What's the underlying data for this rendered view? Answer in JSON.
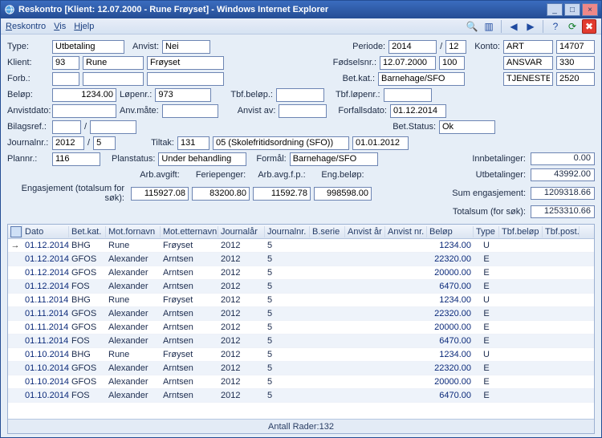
{
  "title": "Reskontro [Klient: 12.07.2000 - Rune Frøyset] - Windows Internet Explorer",
  "menu": {
    "reskontro": "Reskontro",
    "vis": "Vis",
    "hjelp": "Hjelp"
  },
  "form": {
    "labels": {
      "type": "Type:",
      "klient": "Klient:",
      "forb": "Forb.:",
      "anvist": "Anvist:",
      "periode": "Periode:",
      "fodselsnr": "Fødselsnr.:",
      "betkat": "Bet.kat.:",
      "konto": "Konto:",
      "belop": "Beløp:",
      "lopenr": "Løpenr.:",
      "tbfbelop": "Tbf.beløp.:",
      "tbflopenr": "Tbf.løpenr.:",
      "anvistdato": "Anvistdato:",
      "anvmate": "Anv.måte:",
      "anvistav": "Anvist av:",
      "forfallsdato": "Forfallsdato:",
      "betstatus": "Bet.Status:",
      "bilagsref": "Bilagsref.:",
      "journalnr": "Journalnr.:",
      "tiltak": "Tiltak:",
      "plannr": "Plannr.:",
      "planstatus": "Planstatus:",
      "formal": "Formål:",
      "engasjement": "Engasjement (totalsum for søk):",
      "arbavgift": "Arb.avgift:",
      "feriepenger": "Feriepenger:",
      "arbavgfp": "Arb.avg.f.p.:",
      "engbelop": "Eng.beløp:",
      "innbetalinger": "Innbetalinger:",
      "utbetalinger": "Utbetalinger:",
      "sumengasjement": "Sum engasjement:",
      "totalsum": "Totalsum (for søk):"
    },
    "values": {
      "type": "Utbetaling",
      "anvist": "Nei",
      "klient_id": "93",
      "klient_fn": "Rune",
      "klient_en": "Frøyset",
      "periode_y": "2014",
      "periode_m": "12",
      "fodselsnr_d": "12.07.2000",
      "fodselsnr_n": "100",
      "betkat": "Barnehage/SFO",
      "konto1l": "ART",
      "konto1v": "14707",
      "konto2l": "ANSVAR",
      "konto2v": "330",
      "konto3l": "TJENESTE",
      "konto3v": "2520",
      "belop": "1234.00",
      "lopenr": "973",
      "tbfbelop": "",
      "tbflopenr": "",
      "anvistdato": "",
      "anvmate": "",
      "anvistav": "",
      "forfallsdato": "01.12.2014",
      "betstatus": "Ok",
      "bilagsref1": "",
      "bilagsref2": "",
      "journalnr_y": "2012",
      "journalnr_n": "5",
      "tiltak_n": "131",
      "tiltak_txt": "05 (Skolefritidsordning (SFO))",
      "tiltak_d": "01.01.2012",
      "plannr": "116",
      "planstatus": "Under behandling",
      "formal": "Barnehage/SFO",
      "eng_total": "115927.08",
      "arbavgift": "",
      "feriepenger": "83200.80",
      "arbavgfp": "11592.78",
      "engbelop": "998598.00",
      "innbetalinger": "0.00",
      "utbetalinger": "43992.00",
      "sumengasjement": "1209318.66",
      "totalsum": "1253310.66"
    }
  },
  "table": {
    "headers": {
      "dato": "Dato",
      "betkat": "Bet.kat.",
      "motfornavn": "Mot.fornavn",
      "motetternavn": "Mot.etternavn",
      "journalar": "Journalår",
      "journalnr": "Journalnr.",
      "bserie": "B.serie",
      "anvistar": "Anvist år",
      "anvistnr": "Anvist nr.",
      "belop": "Beløp",
      "type": "Type",
      "tbfbelop": "Tbf.beløp",
      "tbfpost": "Tbf.post."
    },
    "rows": [
      {
        "dato": "01.12.2014",
        "betkat": "BHG",
        "fn": "Rune",
        "en": "Frøyset",
        "jaar": "2012",
        "jnr": "5",
        "belop": "1234.00",
        "type": "U"
      },
      {
        "dato": "01.12.2014",
        "betkat": "GFOS",
        "fn": "Alexander",
        "en": "Arntsen",
        "jaar": "2012",
        "jnr": "5",
        "belop": "22320.00",
        "type": "E"
      },
      {
        "dato": "01.12.2014",
        "betkat": "GFOS",
        "fn": "Alexander",
        "en": "Arntsen",
        "jaar": "2012",
        "jnr": "5",
        "belop": "20000.00",
        "type": "E"
      },
      {
        "dato": "01.12.2014",
        "betkat": "FOS",
        "fn": "Alexander",
        "en": "Arntsen",
        "jaar": "2012",
        "jnr": "5",
        "belop": "6470.00",
        "type": "E"
      },
      {
        "dato": "01.11.2014",
        "betkat": "BHG",
        "fn": "Rune",
        "en": "Frøyset",
        "jaar": "2012",
        "jnr": "5",
        "belop": "1234.00",
        "type": "U"
      },
      {
        "dato": "01.11.2014",
        "betkat": "GFOS",
        "fn": "Alexander",
        "en": "Arntsen",
        "jaar": "2012",
        "jnr": "5",
        "belop": "22320.00",
        "type": "E"
      },
      {
        "dato": "01.11.2014",
        "betkat": "GFOS",
        "fn": "Alexander",
        "en": "Arntsen",
        "jaar": "2012",
        "jnr": "5",
        "belop": "20000.00",
        "type": "E"
      },
      {
        "dato": "01.11.2014",
        "betkat": "FOS",
        "fn": "Alexander",
        "en": "Arntsen",
        "jaar": "2012",
        "jnr": "5",
        "belop": "6470.00",
        "type": "E"
      },
      {
        "dato": "01.10.2014",
        "betkat": "BHG",
        "fn": "Rune",
        "en": "Frøyset",
        "jaar": "2012",
        "jnr": "5",
        "belop": "1234.00",
        "type": "U"
      },
      {
        "dato": "01.10.2014",
        "betkat": "GFOS",
        "fn": "Alexander",
        "en": "Arntsen",
        "jaar": "2012",
        "jnr": "5",
        "belop": "22320.00",
        "type": "E"
      },
      {
        "dato": "01.10.2014",
        "betkat": "GFOS",
        "fn": "Alexander",
        "en": "Arntsen",
        "jaar": "2012",
        "jnr": "5",
        "belop": "20000.00",
        "type": "E"
      },
      {
        "dato": "01.10.2014",
        "betkat": "FOS",
        "fn": "Alexander",
        "en": "Arntsen",
        "jaar": "2012",
        "jnr": "5",
        "belop": "6470.00",
        "type": "E"
      }
    ],
    "footer": "Antall Rader:132"
  }
}
